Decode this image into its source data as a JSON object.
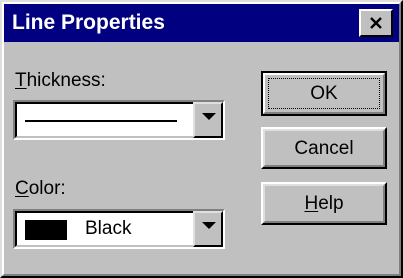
{
  "dialog": {
    "title": "Line Properties",
    "close_icon": "close-icon"
  },
  "thickness": {
    "label_accel": "T",
    "label_rest": "hickness:",
    "value": "thin-line",
    "dropdown_icon": "chevron-down-icon"
  },
  "color": {
    "label_accel": "C",
    "label_rest": "olor:",
    "value": "Black",
    "swatch_color": "#000000",
    "dropdown_icon": "chevron-down-icon"
  },
  "buttons": {
    "ok": "OK",
    "cancel": "Cancel",
    "help_accel": "H",
    "help_rest": "elp"
  },
  "colors": {
    "titlebar": "#000080",
    "face": "#c0c0c0"
  }
}
